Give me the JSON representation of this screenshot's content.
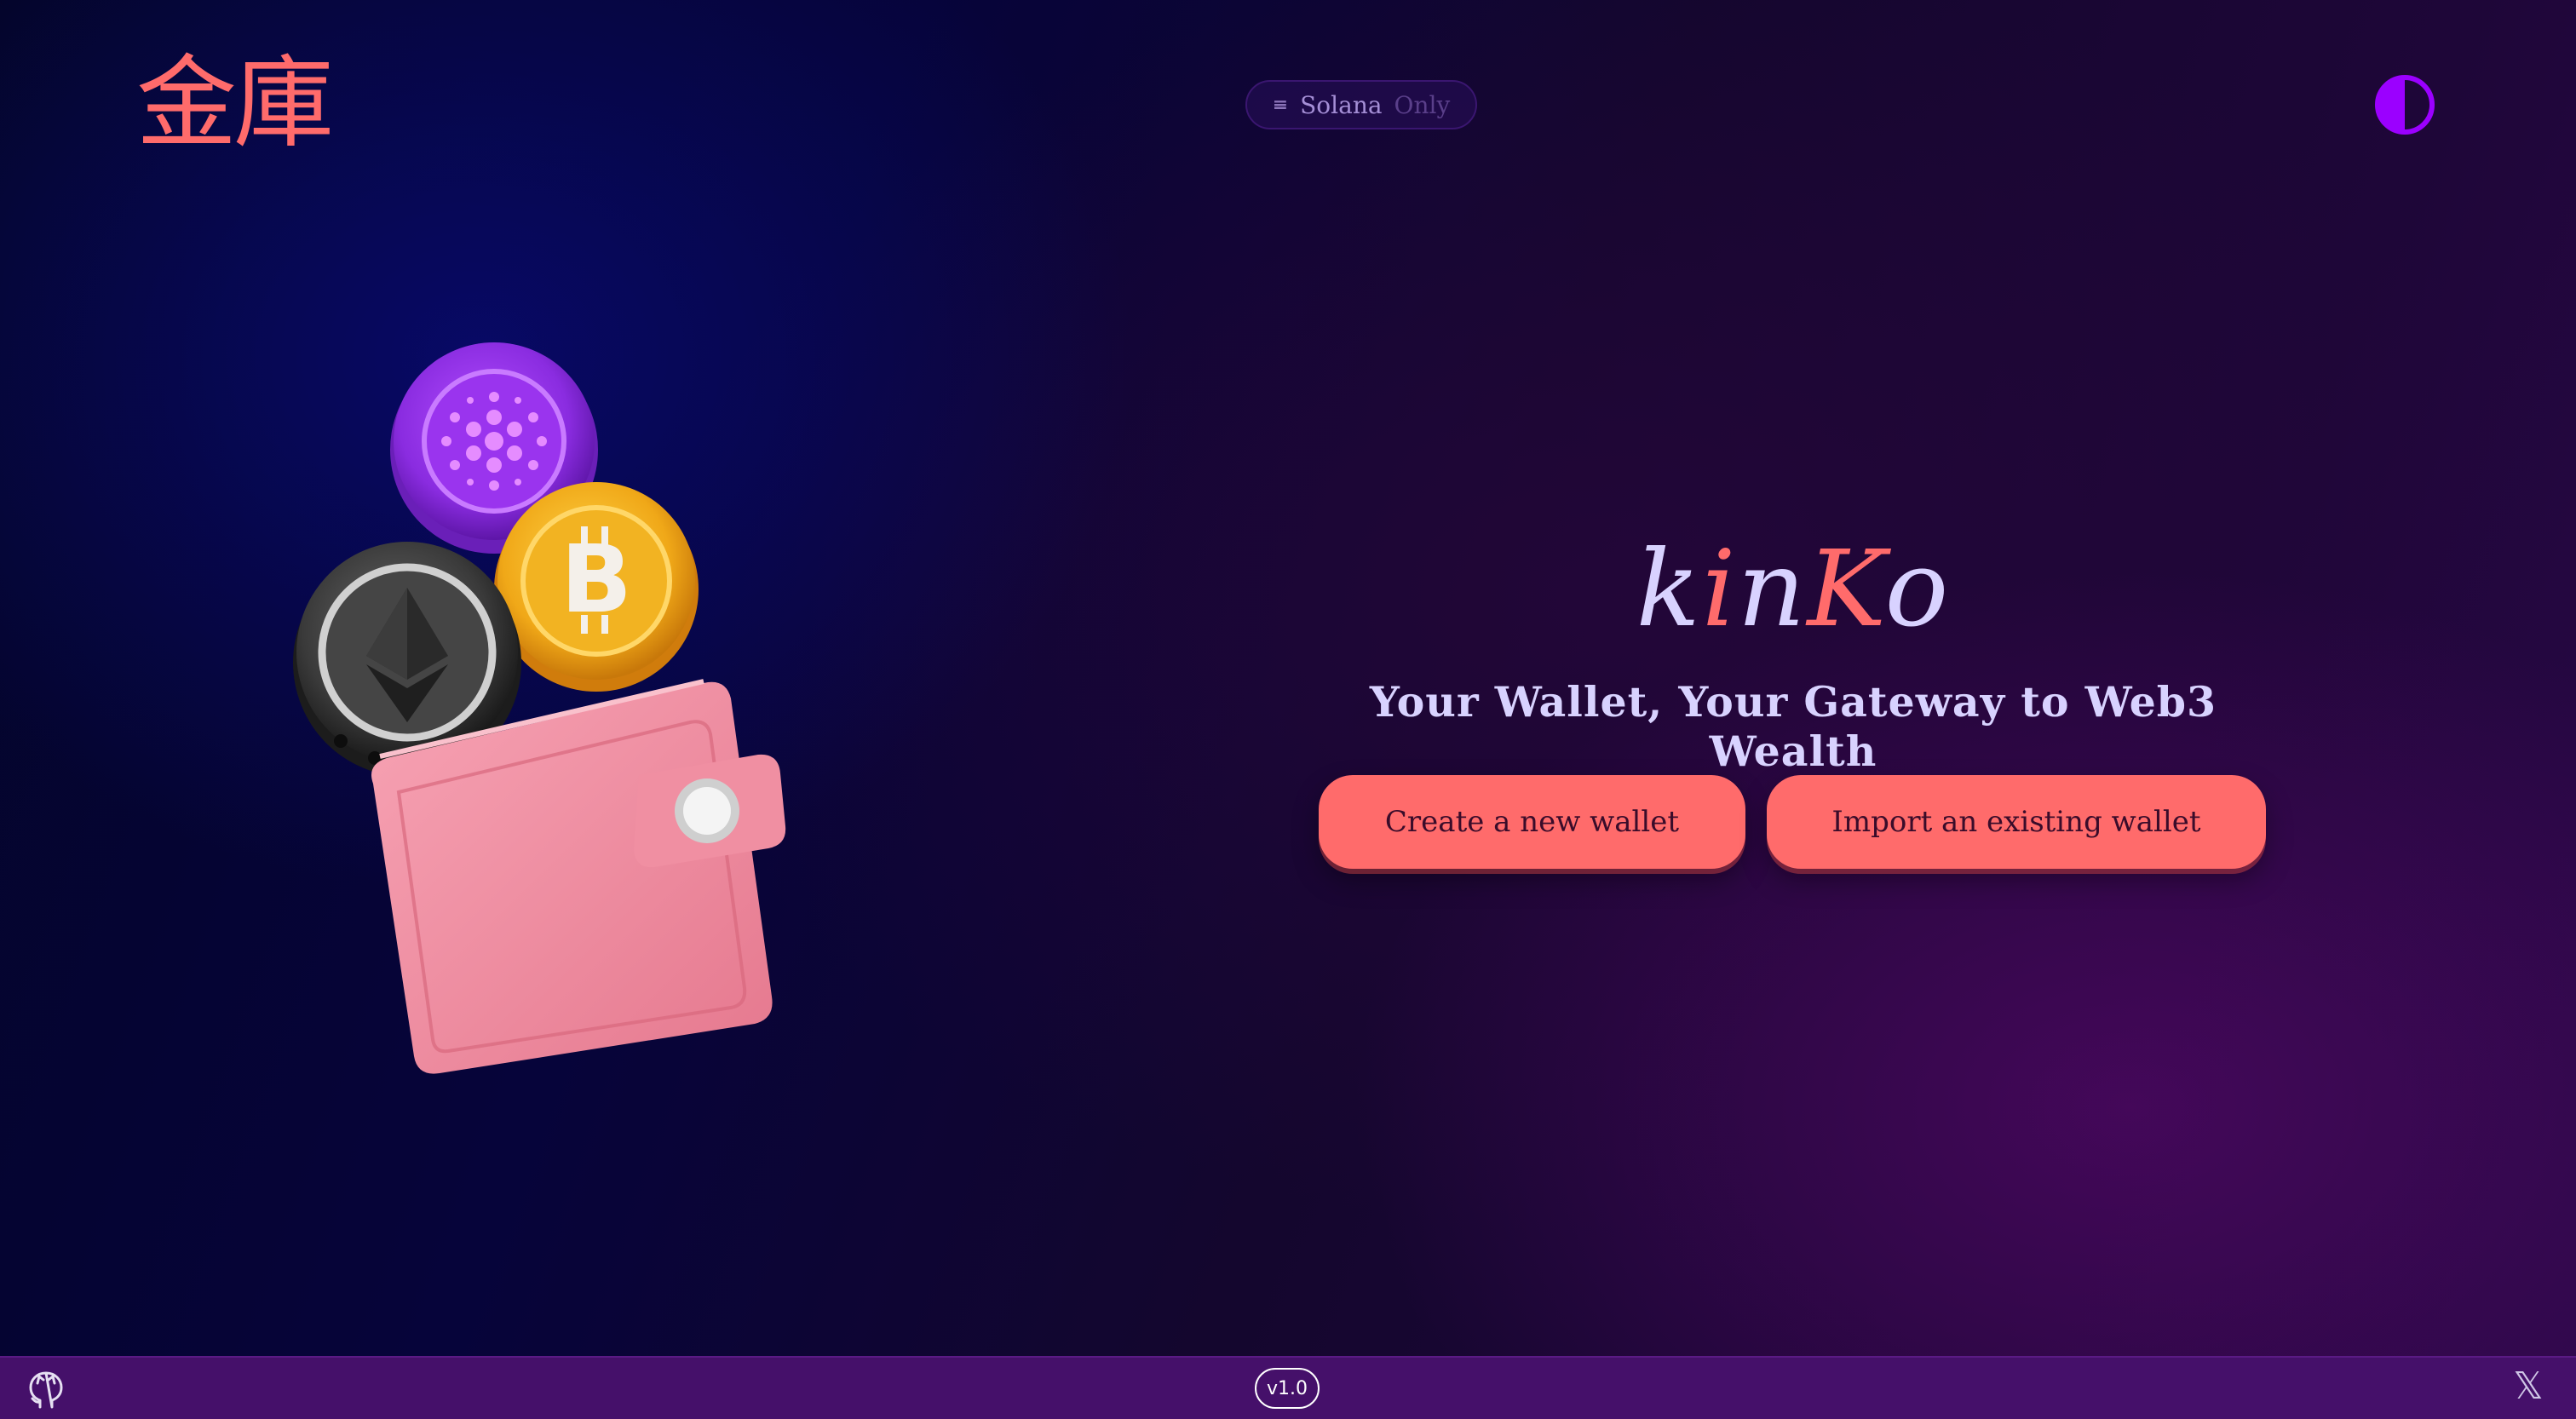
{
  "header": {
    "logo": "金庫",
    "network_pill": {
      "icon": "solana-icon",
      "name": "Solana",
      "suffix": "Only"
    },
    "theme_toggle": "contrast-icon"
  },
  "hero": {
    "brand_part1": "k",
    "brand_part2": "i",
    "brand_part3": "n",
    "brand_part4": "K",
    "brand_part5": "o",
    "tagline": "Your Wallet, Your Gateway to Web3 Wealth",
    "create_button": "Create a new wallet",
    "import_button": "Import an existing wallet"
  },
  "illustration": {
    "icons": [
      "cardano-coin-icon",
      "bitcoin-coin-icon",
      "ethereum-coin-icon",
      "wallet-icon"
    ]
  },
  "footer": {
    "github": "github-icon",
    "version": "v1.0",
    "x": "x-twitter-icon"
  },
  "colors": {
    "accent": "#ff6b6b",
    "brand_light": "#d8d2ff",
    "toggle": "#9b00ff",
    "footer": "#45106a"
  }
}
